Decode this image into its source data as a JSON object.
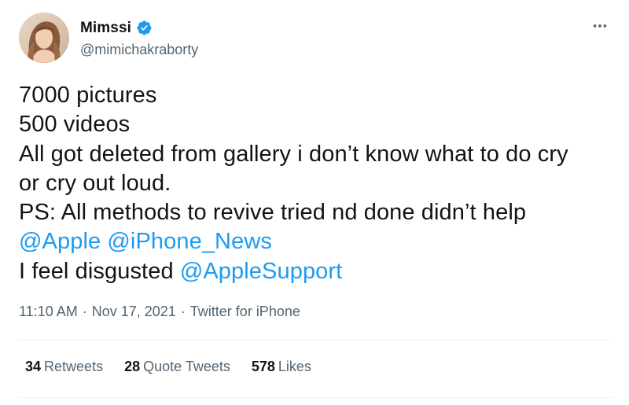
{
  "author": {
    "display_name": "Mimssi",
    "handle": "@mimichakraborty",
    "verified": true
  },
  "tweet": {
    "lines": [
      [
        {
          "text": "7000 pictures",
          "type": "text"
        }
      ],
      [
        {
          "text": "500 videos",
          "type": "text"
        }
      ],
      [
        {
          "text": "All got deleted from gallery i don’t know what to do cry",
          "type": "text"
        }
      ],
      [
        {
          "text": "or cry out loud.",
          "type": "text"
        }
      ],
      [
        {
          "text": "PS: All methods to revive tried nd done didn’t help",
          "type": "text"
        }
      ],
      [
        {
          "text": "@Apple",
          "type": "mention"
        },
        {
          "text": " ",
          "type": "text"
        },
        {
          "text": "@iPhone_News",
          "type": "mention"
        }
      ],
      [
        {
          "text": "I feel disgusted ",
          "type": "text"
        },
        {
          "text": "@AppleSupport",
          "type": "mention"
        }
      ]
    ],
    "time": "11:10 AM",
    "date": "Nov 17, 2021",
    "separator": "·",
    "source": "Twitter for iPhone"
  },
  "stats": {
    "retweets_count": "34",
    "retweets_label": "Retweets",
    "quote_count": "28",
    "quote_label": "Quote Tweets",
    "likes_count": "578",
    "likes_label": "Likes"
  },
  "colors": {
    "accent": "#1d9bf0",
    "text": "#0f1419",
    "secondary": "#536471",
    "divider": "#eff3f4"
  },
  "icons": {
    "verified": "verified-badge-icon",
    "more": "more-horizontal-icon"
  }
}
